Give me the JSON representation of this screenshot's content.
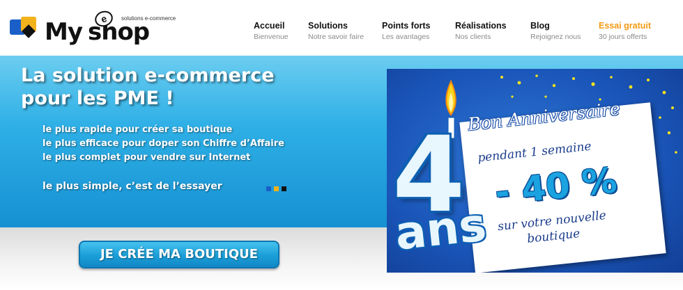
{
  "header": {
    "logo": {
      "text_my": "My",
      "text_shop": "shop",
      "e_letter": "e",
      "tagline": "solutions e-commerce"
    },
    "nav": [
      {
        "title": "Accueil",
        "subtitle": "Bienvenue"
      },
      {
        "title": "Solutions",
        "subtitle": "Notre savoir faire"
      },
      {
        "title": "Points forts",
        "subtitle": "Les avantages"
      },
      {
        "title": "Réalisations",
        "subtitle": "Nos clients"
      },
      {
        "title": "Blog",
        "subtitle": "Rejoignez nous"
      },
      {
        "title": "Essai gratuit",
        "subtitle": "30 jours offerts"
      }
    ]
  },
  "hero": {
    "title_line1": "La solution e-commerce",
    "title_line2": "pour les PME !",
    "bullets": [
      "le plus rapide pour créer sa boutique",
      "le plus efficace pour doper son Chiffre d’Affaire",
      "le plus complet pour vendre sur Internet"
    ],
    "tagline": "le plus simple, c’est de l’essayer",
    "squares_colors": [
      "#1a5fc8",
      "#f2b21c",
      "#111111"
    ]
  },
  "cta": {
    "label": "JE CRÉE MA BOUTIQUE"
  },
  "promo": {
    "title": "Bon Anniversaire",
    "line1": "pendant 1 semaine",
    "discount": "- 40 %",
    "line3a": "sur votre nouvelle",
    "line3b": "boutique",
    "number": "4",
    "ans": "ans"
  },
  "colors": {
    "accent": "#f39a12",
    "hero_blue": "#2fb0e6",
    "promo_blue": "#1a55b8"
  }
}
